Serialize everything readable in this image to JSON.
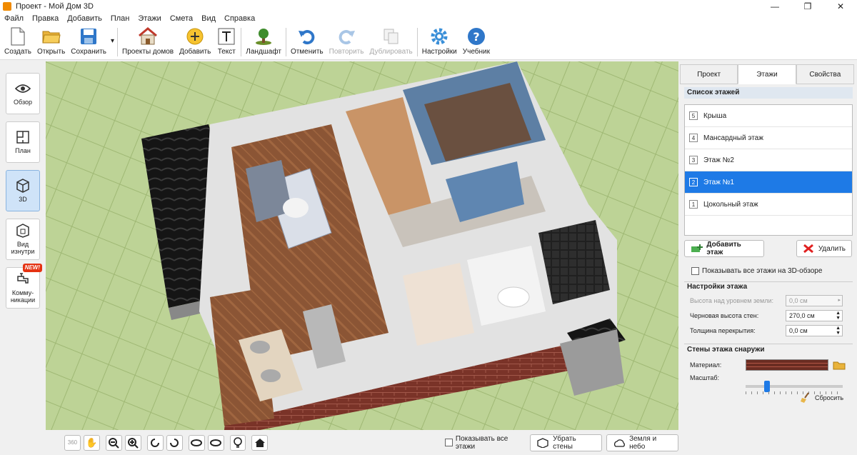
{
  "window": {
    "title": "Проект - Мой Дом 3D",
    "minimize": "—",
    "restore": "❐",
    "close": "✕"
  },
  "menu": [
    "Файл",
    "Правка",
    "Добавить",
    "План",
    "Этажи",
    "Смета",
    "Вид",
    "Справка"
  ],
  "toolbar": {
    "create": "Создать",
    "open": "Открыть",
    "save": "Сохранить",
    "save_arrow": "▾",
    "house_projects": "Проекты домов",
    "add": "Добавить",
    "text": "Текст",
    "landscape": "Ландшафт",
    "undo": "Отменить",
    "redo": "Повторить",
    "duplicate": "Дублировать",
    "settings": "Настройки",
    "tutorial": "Учебник"
  },
  "leftbar": {
    "overview": "Обзор",
    "plan": "План",
    "view3d": "3D",
    "inside_view": "Вид изнутри",
    "communications": "Комму-никации",
    "new_badge": "NEW!"
  },
  "bottombar": {
    "show_all_floors": "Показывать все этажи",
    "remove_walls": "Убрать стены",
    "earth_sky": "Земля и небо"
  },
  "right_panel": {
    "tabs": [
      "Проект",
      "Этажи",
      "Свойства"
    ],
    "floor_list_title": "Список этажей",
    "floors": [
      {
        "num": "5",
        "name": "Крыша"
      },
      {
        "num": "4",
        "name": "Мансардный этаж"
      },
      {
        "num": "3",
        "name": "Этаж №2"
      },
      {
        "num": "2",
        "name": "Этаж №1"
      },
      {
        "num": "1",
        "name": "Цокольный этаж"
      }
    ],
    "selected_floor": "Этаж №1",
    "add_floor": "Добавить этаж",
    "delete": "Удалить",
    "show_all_3d": "Показывать все этажи на 3D-обзоре",
    "floor_settings_title": "Настройки этажа",
    "height_above_ground_label": "Высота над уровнем земли:",
    "height_above_ground": "0,0 см",
    "rough_wall_height_label": "Черновая высота стен:",
    "rough_wall_height": "270,0 см",
    "slab_thickness_label": "Толщина перекрытия:",
    "slab_thickness": "0,0 см",
    "outer_walls_title": "Стены этажа снаружи",
    "material_label": "Материал:",
    "scale_label": "Масштаб:",
    "reset": "Сбросить",
    "scale_value": 0.2
  }
}
